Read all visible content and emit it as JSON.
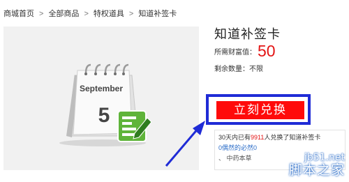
{
  "breadcrumb": {
    "items": [
      "商城首页",
      "全部商品",
      "特权道具",
      "知道补签卡"
    ],
    "separator": ">"
  },
  "product": {
    "title": "知道补签卡",
    "price_label": "所需财富值：",
    "price_value": "50",
    "stock_label": "剩余数量：不限",
    "image": {
      "month": "September",
      "day": "5",
      "icon": "calendar-edit-icon"
    }
  },
  "actions": {
    "redeem_label": "立刻兑换"
  },
  "info": {
    "line1_prefix": "30天内已有",
    "line1_count": "9911",
    "line1_suffix": "人兑换了知道补签卡",
    "line2": "0偶然的必然0",
    "line3": "、 中药本草"
  },
  "watermark": {
    "url": "jb51.net",
    "name": "脚本之家"
  },
  "colors": {
    "price": "#e31414",
    "button": "#ff0a0a",
    "highlight": "#1f2bd6",
    "link": "#2a6cc8"
  }
}
